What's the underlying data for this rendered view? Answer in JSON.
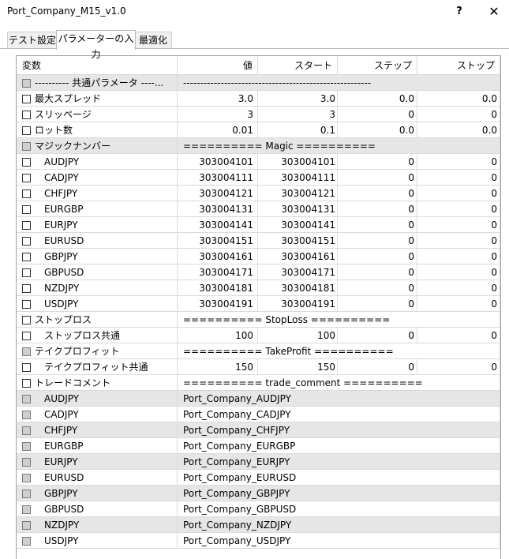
{
  "window": {
    "title": "Port_Company_M15_v1.0",
    "help_label": "?",
    "close_label": "✕"
  },
  "tabs": [
    {
      "label": "テスト設定",
      "active": false
    },
    {
      "label": "パラメーターの入力",
      "active": true
    },
    {
      "label": "最適化",
      "active": false
    }
  ],
  "columns": [
    "変数",
    "値",
    "スタート",
    "ステップ",
    "ストップ"
  ],
  "rows": [
    {
      "name": "----------   共通パラメータ   ----...",
      "span": "-------------------------------------------------------",
      "gray": true,
      "disabled": true,
      "indent": false
    },
    {
      "name": "最大スプレッド",
      "value": "3.0",
      "start": "3.0",
      "step": "0.0",
      "stop": "0.0",
      "gray": false,
      "disabled": false,
      "indent": false
    },
    {
      "name": "スリッページ",
      "value": "3",
      "start": "3",
      "step": "0",
      "stop": "0",
      "gray": false,
      "disabled": false,
      "indent": false
    },
    {
      "name": "ロット数",
      "value": "0.01",
      "start": "0.1",
      "step": "0.0",
      "stop": "0.0",
      "gray": false,
      "disabled": false,
      "indent": false
    },
    {
      "name": "マジックナンバー",
      "span": "==========  Magic  ==========",
      "gray": true,
      "disabled": true,
      "indent": false
    },
    {
      "name": "AUDJPY",
      "value": "303004101",
      "start": "303004101",
      "step": "0",
      "stop": "0",
      "gray": false,
      "disabled": false,
      "indent": true
    },
    {
      "name": "CADJPY",
      "value": "303004111",
      "start": "303004111",
      "step": "0",
      "stop": "0",
      "gray": false,
      "disabled": false,
      "indent": true
    },
    {
      "name": "CHFJPY",
      "value": "303004121",
      "start": "303004121",
      "step": "0",
      "stop": "0",
      "gray": false,
      "disabled": false,
      "indent": true
    },
    {
      "name": "EURGBP",
      "value": "303004131",
      "start": "303004131",
      "step": "0",
      "stop": "0",
      "gray": false,
      "disabled": false,
      "indent": true
    },
    {
      "name": "EURJPY",
      "value": "303004141",
      "start": "303004141",
      "step": "0",
      "stop": "0",
      "gray": false,
      "disabled": false,
      "indent": true
    },
    {
      "name": "EURUSD",
      "value": "303004151",
      "start": "303004151",
      "step": "0",
      "stop": "0",
      "gray": false,
      "disabled": false,
      "indent": true
    },
    {
      "name": "GBPJPY",
      "value": "303004161",
      "start": "303004161",
      "step": "0",
      "stop": "0",
      "gray": false,
      "disabled": false,
      "indent": true
    },
    {
      "name": "GBPUSD",
      "value": "303004171",
      "start": "303004171",
      "step": "0",
      "stop": "0",
      "gray": false,
      "disabled": false,
      "indent": true
    },
    {
      "name": "NZDJPY",
      "value": "303004181",
      "start": "303004181",
      "step": "0",
      "stop": "0",
      "gray": false,
      "disabled": false,
      "indent": true
    },
    {
      "name": "USDJPY",
      "value": "303004191",
      "start": "303004191",
      "step": "0",
      "stop": "0",
      "gray": false,
      "disabled": false,
      "indent": true
    },
    {
      "name": "ストップロス",
      "span": "==========  StopLoss  ==========",
      "gray": false,
      "disabled": false,
      "indent": false
    },
    {
      "name": "ストップロス共通",
      "value": "100",
      "start": "100",
      "step": "0",
      "stop": "0",
      "gray": false,
      "disabled": false,
      "indent": true
    },
    {
      "name": "テイクプロフィット",
      "span": "==========  TakeProfit  ==========",
      "gray": false,
      "disabled": true,
      "indent": false
    },
    {
      "name": "テイクプロフィット共通",
      "value": "150",
      "start": "150",
      "step": "0",
      "stop": "0",
      "gray": false,
      "disabled": false,
      "indent": true
    },
    {
      "name": "トレードコメント",
      "span": "==========  trade_comment  ==========",
      "gray": false,
      "disabled": false,
      "indent": false
    },
    {
      "name": "AUDJPY",
      "span": "Port_Company_AUDJPY",
      "gray": true,
      "disabled": true,
      "indent": true
    },
    {
      "name": "CADJPY",
      "span": "Port_Company_CADJPY",
      "gray": false,
      "disabled": true,
      "indent": true
    },
    {
      "name": "CHFJPY",
      "span": "Port_Company_CHFJPY",
      "gray": true,
      "disabled": true,
      "indent": true
    },
    {
      "name": "EURGBP",
      "span": "Port_Company_EURGBP",
      "gray": false,
      "disabled": true,
      "indent": true
    },
    {
      "name": "EURJPY",
      "span": "Port_Company_EURJPY",
      "gray": true,
      "disabled": true,
      "indent": true
    },
    {
      "name": "EURUSD",
      "span": "Port_Company_EURUSD",
      "gray": false,
      "disabled": true,
      "indent": true
    },
    {
      "name": "GBPJPY",
      "span": "Port_Company_GBPJPY",
      "gray": true,
      "disabled": true,
      "indent": true
    },
    {
      "name": "GBPUSD",
      "span": "Port_Company_GBPUSD",
      "gray": false,
      "disabled": true,
      "indent": true
    },
    {
      "name": "NZDJPY",
      "span": "Port_Company_NZDJPY",
      "gray": true,
      "disabled": true,
      "indent": true
    },
    {
      "name": "USDJPY",
      "span": "Port_Company_USDJPY",
      "gray": false,
      "disabled": true,
      "indent": true
    }
  ]
}
